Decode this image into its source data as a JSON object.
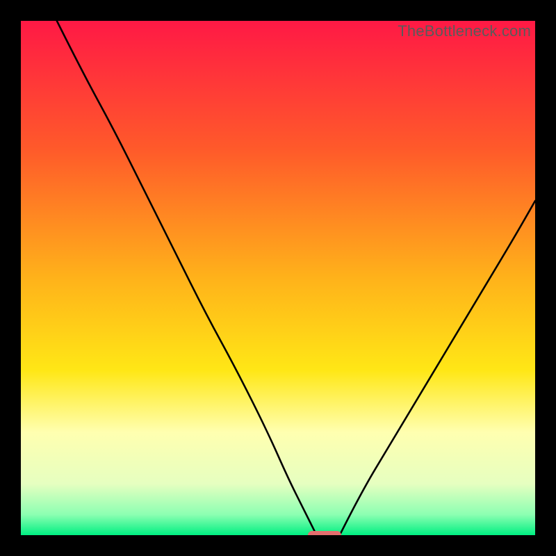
{
  "watermark": "TheBottleneck.com",
  "colors": {
    "red_top": "#ff1945",
    "orange": "#ff8a1f",
    "yellow": "#ffe716",
    "pale_yellow": "#ffffb0",
    "light_green": "#c7ffb3",
    "green": "#00ef82",
    "frame_black": "#000000",
    "marker": "#e46e6e",
    "curve": "#000000"
  },
  "chart_data": {
    "type": "line",
    "title": "",
    "xlabel": "",
    "ylabel": "",
    "xlim": [
      0,
      100
    ],
    "ylim": [
      0,
      100
    ],
    "gradient_stops": [
      {
        "offset": 0,
        "color": "#ff1945"
      },
      {
        "offset": 25,
        "color": "#ff5a2a"
      },
      {
        "offset": 50,
        "color": "#ffb21a"
      },
      {
        "offset": 68,
        "color": "#ffe716"
      },
      {
        "offset": 80,
        "color": "#ffffb0"
      },
      {
        "offset": 90,
        "color": "#e6ffc0"
      },
      {
        "offset": 96,
        "color": "#8cffb2"
      },
      {
        "offset": 100,
        "color": "#00ef82"
      }
    ],
    "series": [
      {
        "name": "left-curve",
        "x": [
          7,
          12,
          18,
          24,
          30,
          36,
          42,
          48,
          52,
          55,
          57.5
        ],
        "y": [
          100,
          90,
          79,
          67,
          55,
          43,
          32,
          20,
          11,
          5,
          0
        ]
      },
      {
        "name": "right-curve",
        "x": [
          62,
          66,
          72,
          78,
          84,
          90,
          96,
          100
        ],
        "y": [
          0,
          8,
          18,
          28,
          38,
          48,
          58,
          65
        ]
      }
    ],
    "marker": {
      "name": "bottleneck-marker",
      "x_center": 59,
      "y": 0,
      "width_pct": 6.5,
      "height_pct": 1.6
    },
    "gridlines": false,
    "legend": false
  }
}
